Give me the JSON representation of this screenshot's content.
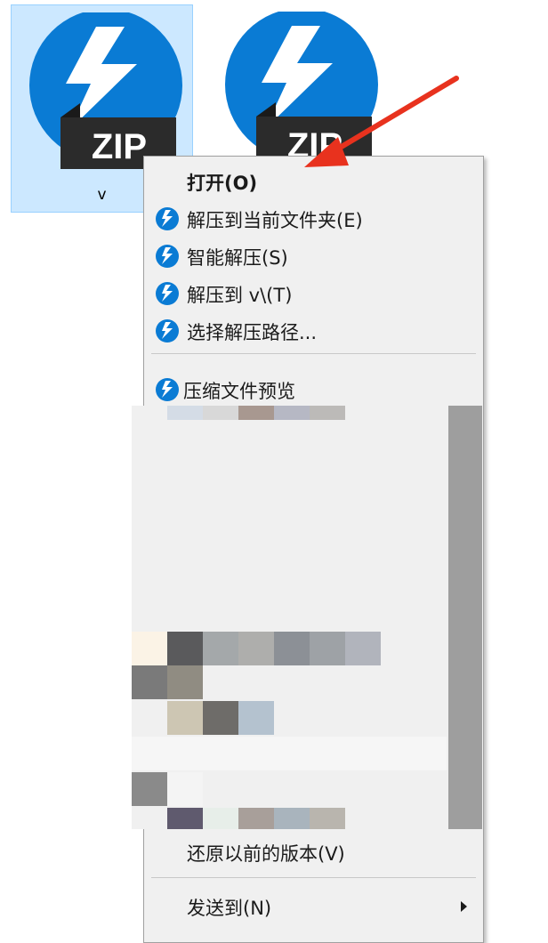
{
  "desktop": {
    "files": [
      {
        "label": "v",
        "badge": "ZIP"
      },
      {
        "label": "",
        "badge": "ZIP"
      }
    ]
  },
  "context_menu": {
    "items": [
      {
        "label": "打开(O)"
      },
      {
        "label": "解压到当前文件夹(E)",
        "icon": "bandizip-icon"
      },
      {
        "label": "智能解压(S)",
        "icon": "bandizip-icon"
      },
      {
        "label": "解压到 v\\(T)",
        "icon": "bandizip-icon"
      },
      {
        "label": "选择解压路径...",
        "icon": "bandizip-icon"
      },
      {
        "label": "压缩文件预览",
        "icon": "bandizip-icon"
      },
      {
        "label": "还原以前的版本(V)"
      },
      {
        "label": "发送到(N)"
      }
    ]
  },
  "colors": {
    "accent": "#0a7bd4",
    "selection": "#cce8ff",
    "arrow": "#e8321e",
    "menu_bg": "#f0f0f0"
  }
}
